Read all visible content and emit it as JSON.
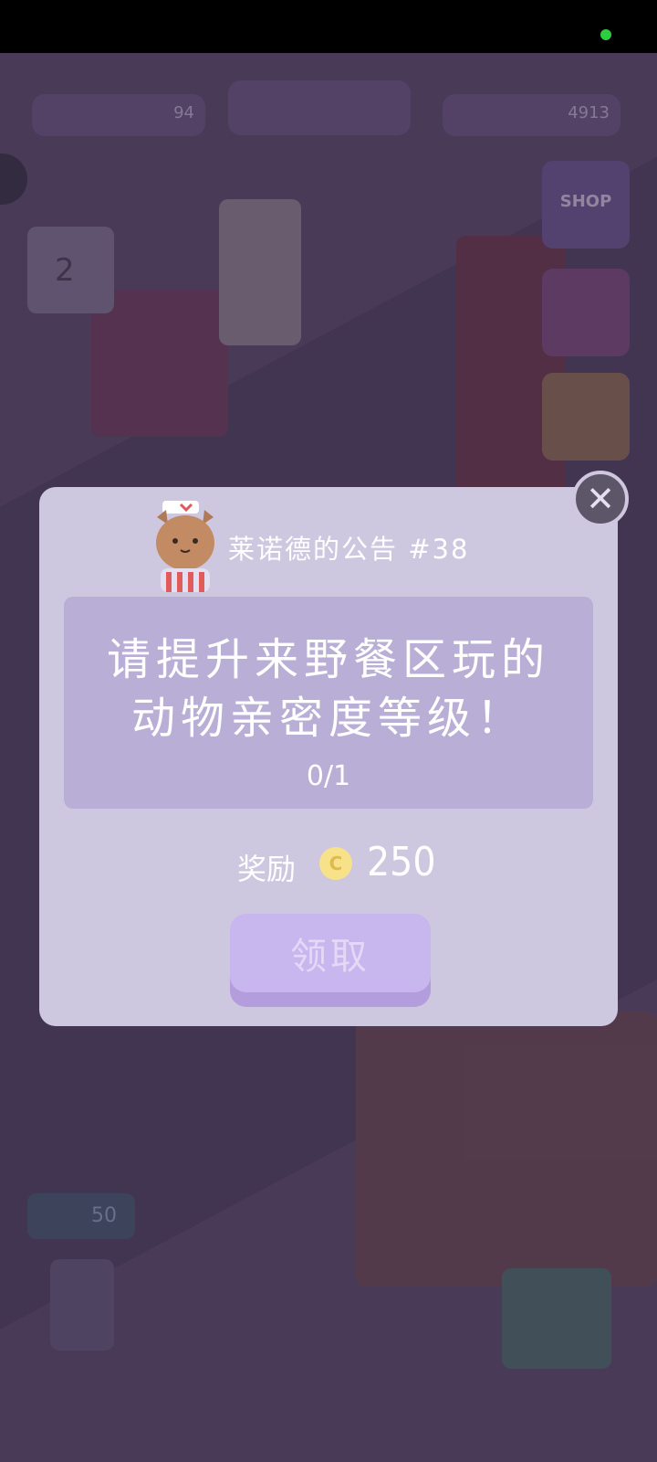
{
  "dialog": {
    "title": "莱诺德的公告 #38",
    "task_line1": "请提升来野餐区玩的",
    "task_line2": "动物亲密度等级！",
    "progress": "0/1",
    "reward_label": "奖励",
    "reward_currency_symbol": "C",
    "reward_value": "250",
    "claim_button": "领取",
    "close_icon": "✕"
  },
  "hud": {
    "level_value": "94",
    "coin_value": "4913",
    "shop_label": "SHOP",
    "calendar_day": "2",
    "jar_value": "50"
  },
  "colors": {
    "dialog_bg": "#cec7e0",
    "task_box": "#b8aed6",
    "claim_button": "#c8b6ef"
  }
}
